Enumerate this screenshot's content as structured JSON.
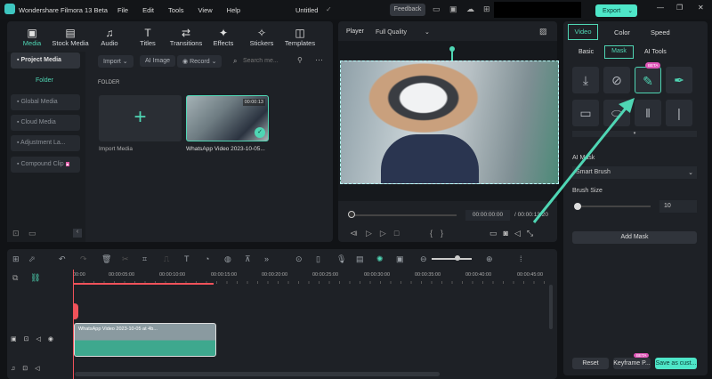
{
  "app": {
    "title": "Wondershare Filmora 13 Beta",
    "menu": [
      "File",
      "Edit",
      "Tools",
      "View",
      "Help"
    ],
    "project": "Untitled",
    "feedback": "Feedback",
    "export": "Export"
  },
  "media_tabs": [
    {
      "label": "Media",
      "icon": "media-icon"
    },
    {
      "label": "Stock Media",
      "icon": "stock-icon"
    },
    {
      "label": "Audio",
      "icon": "audio-icon"
    },
    {
      "label": "Titles",
      "icon": "titles-icon"
    },
    {
      "label": "Transitions",
      "icon": "transitions-icon"
    },
    {
      "label": "Effects",
      "icon": "effects-icon"
    },
    {
      "label": "Stickers",
      "icon": "stickers-icon"
    },
    {
      "label": "Templates",
      "icon": "templates-icon"
    }
  ],
  "sidebar": {
    "project_media": "Project Media",
    "folder": "Folder",
    "items": [
      "Global Media",
      "Cloud Media",
      "Adjustment La...",
      "Compound Clip"
    ]
  },
  "media_toolbar": {
    "import": "Import",
    "ai_image": "AI Image",
    "record": "Record",
    "search_placeholder": "Search me..."
  },
  "library": {
    "section": "FOLDER",
    "import_label": "Import Media",
    "clip_name": "WhatsApp Video 2023-10-05...",
    "clip_duration": "00:00:13"
  },
  "player": {
    "label": "Player",
    "quality": "Full Quality",
    "current_time": "00:00:00:00",
    "total_time": "00:00:13:20"
  },
  "properties": {
    "tabs": [
      "Video",
      "Color",
      "Speed"
    ],
    "subtabs": [
      "Basic",
      "Mask",
      "AI Tools"
    ],
    "beta_badge": "BETA",
    "ai_mask_label": "AI Mask",
    "ai_mask_value": "Smart Brush",
    "brush_size_label": "Brush Size",
    "brush_size": "10",
    "brush_size_fraction": 0.05,
    "add_mask": "Add Mask",
    "reset": "Reset",
    "keyframe": "Keyframe P...",
    "save": "Save as cust..."
  },
  "timeline": {
    "ruler": [
      "00:00",
      "00:00:05:00",
      "00:00:10:00",
      "00:00:15:00",
      "00:00:20:00",
      "00:00:25:00",
      "00:00:30:00",
      "00:00:35:00",
      "00:00:40:00",
      "00:00:45:00"
    ],
    "clip_label": "WhatsApp Video 2023-10-05 at 4b..."
  },
  "colors": {
    "accent": "#4fd6b4",
    "playhead": "#f0525a"
  }
}
